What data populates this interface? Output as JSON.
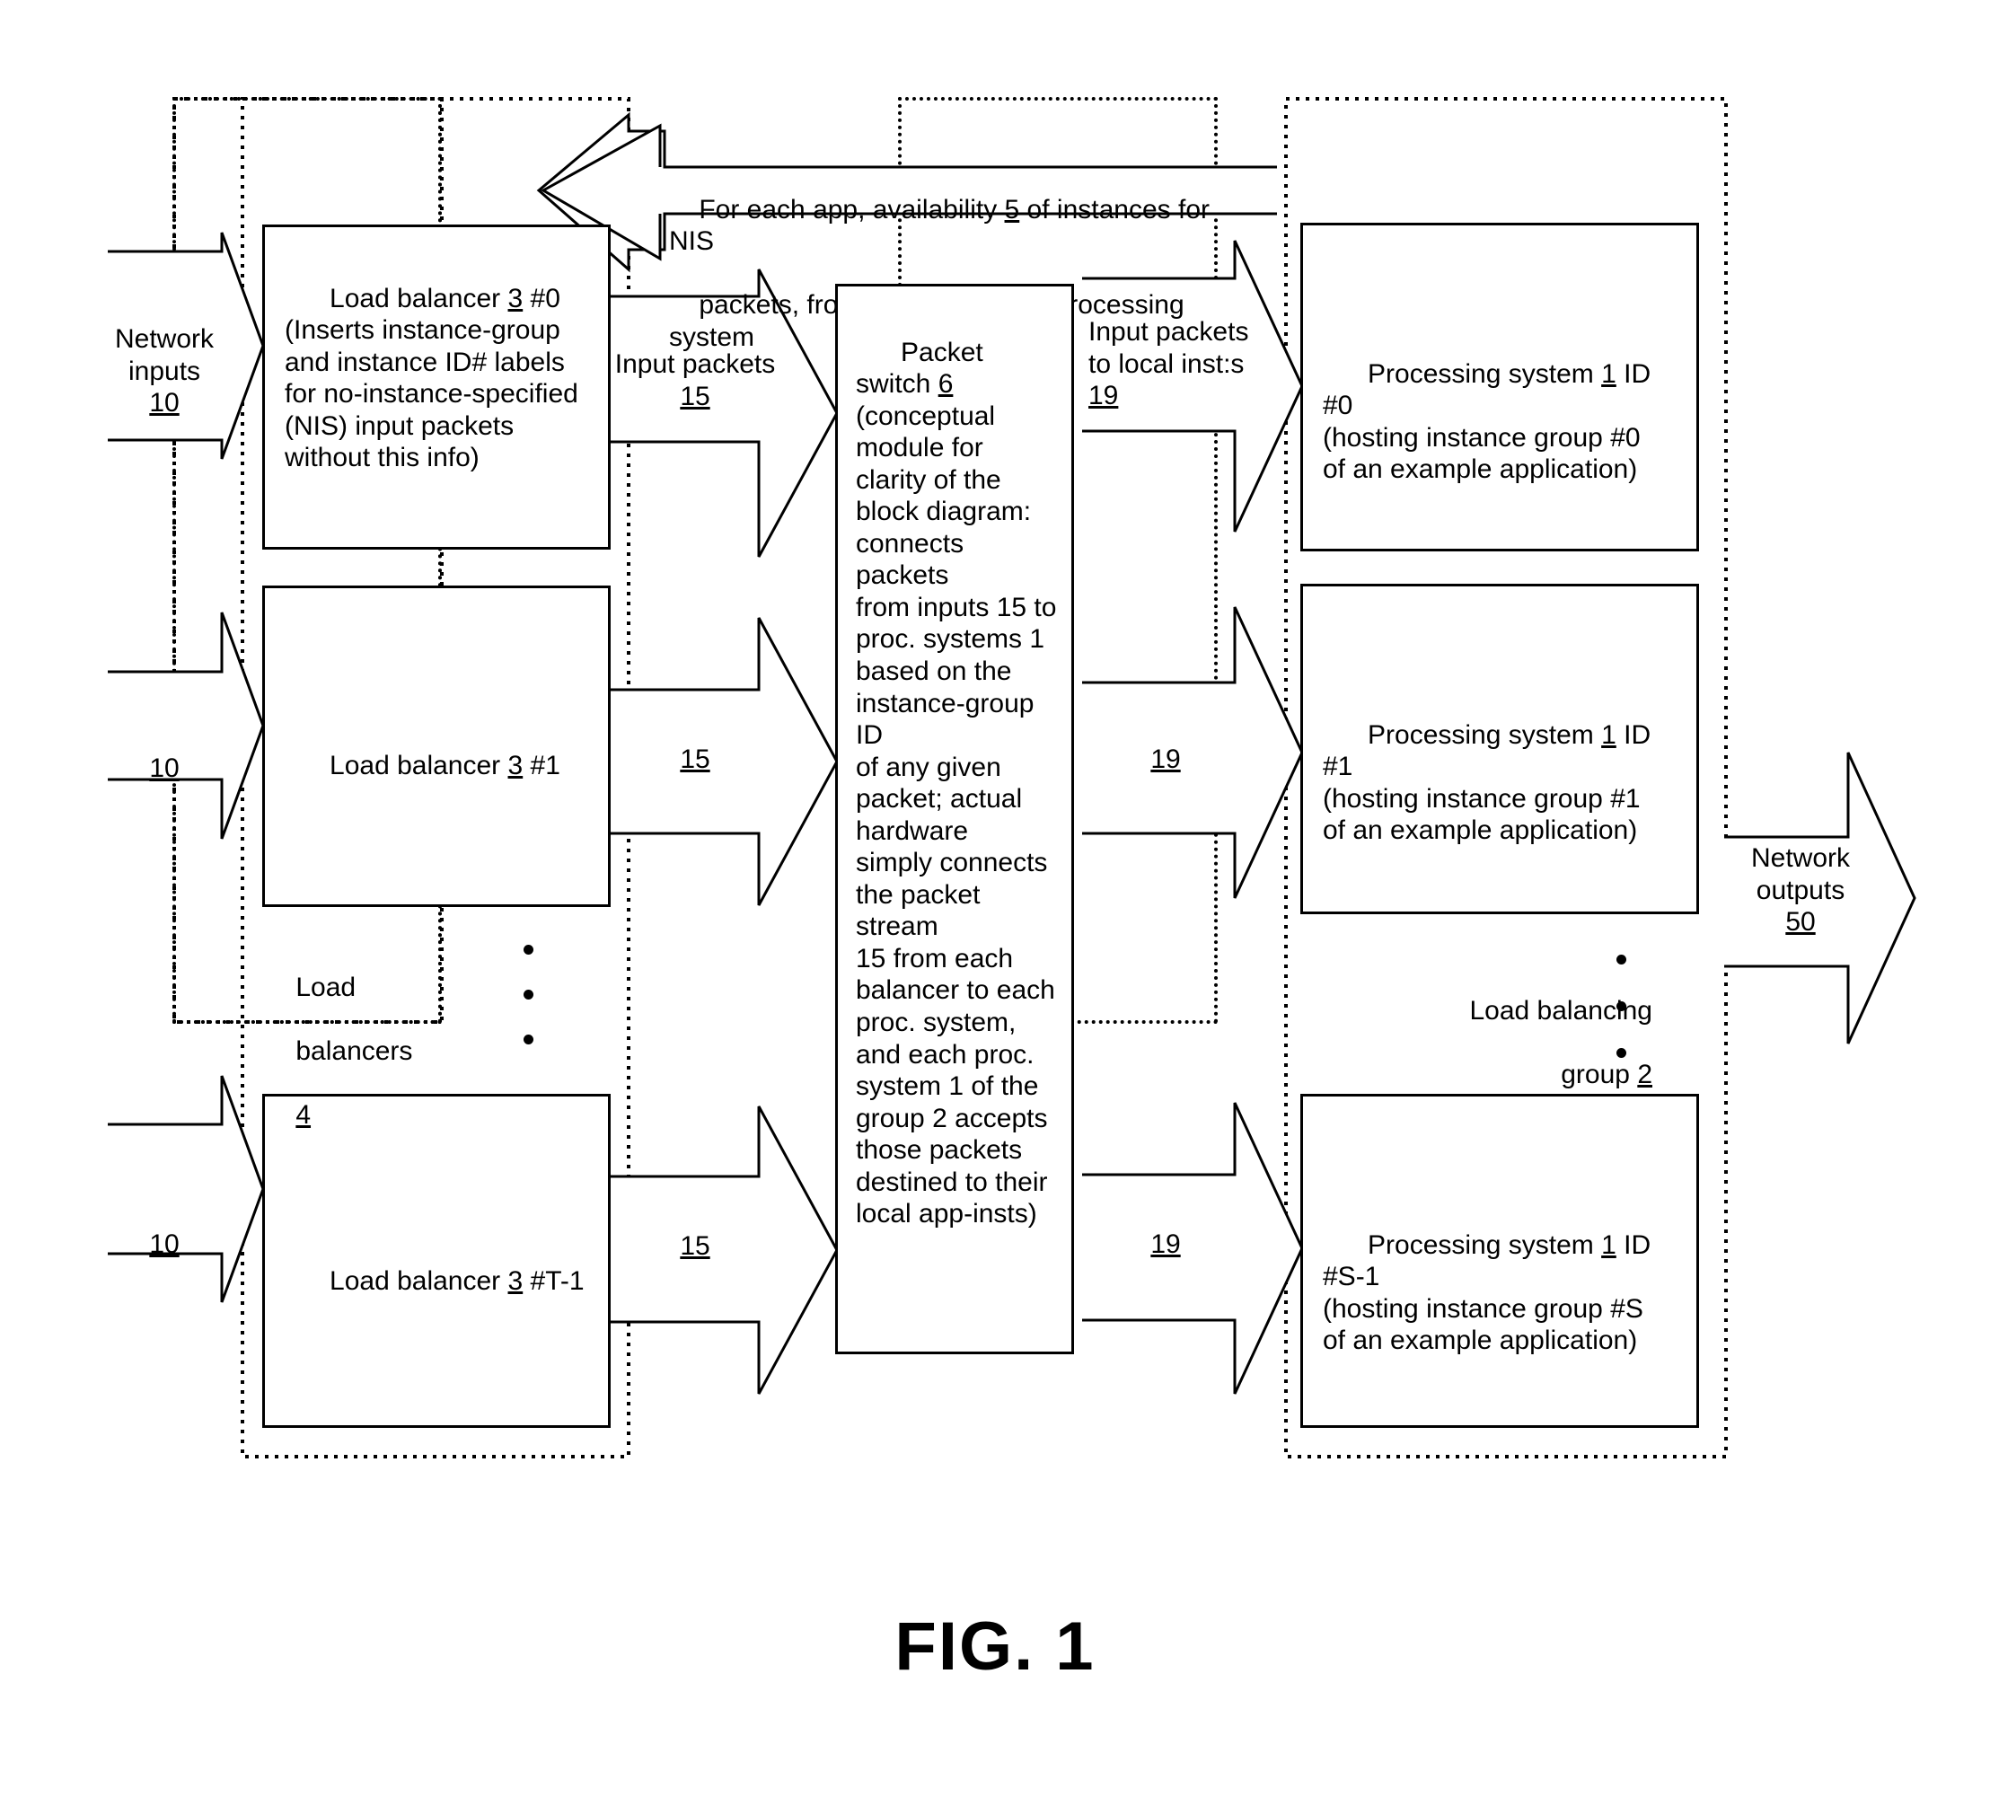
{
  "figure": {
    "caption": "FIG. 1"
  },
  "groups": {
    "load_balancer_group": {
      "label_line1": "Load",
      "label_line2": "balancers",
      "label_ref": "4"
    },
    "processing_group": {
      "label_line1": "Load balancing",
      "label_line2": "group",
      "label_ref": "2"
    }
  },
  "callout": {
    "line1_a": "For each app, availability ",
    "line1_ref": "5",
    "line1_b": " of instances for NIS",
    "line2": "packets, from each individual processing system"
  },
  "network": {
    "inputs_label_line1": "Network",
    "inputs_label_line2": "inputs",
    "inputs_ref": "10",
    "input_ref_2": "10",
    "input_ref_3": "10",
    "outputs_label_line1": "Network",
    "outputs_label_line2": "outputs",
    "outputs_ref": "50"
  },
  "load_balancers": [
    {
      "title_a": "Load balancer ",
      "title_ref": "3",
      "title_b": " #0",
      "body": "(Inserts instance-group\nand instance ID# labels\nfor no-instance-specified\n(NIS) input packets\nwithout this info)"
    },
    {
      "title_a": "Load balancer ",
      "title_ref": "3",
      "title_b": " #1",
      "body": ""
    },
    {
      "title_a": "Load balancer ",
      "title_ref": "3",
      "title_b": " #T-1",
      "body": ""
    }
  ],
  "input_packets": {
    "label_line1": "Input packets",
    "ref": "15",
    "ref_2": "15",
    "ref_3": "15"
  },
  "packet_switch": {
    "title_a": "Packet switch ",
    "title_ref": "6",
    "body": "(conceptual\nmodule for\nclarity of the\nblock diagram:\nconnects packets\nfrom inputs 15 to\nproc. systems 1\nbased on the\ninstance-group ID\nof any given\npacket; actual\nhardware\nsimply connects\nthe packet stream\n15 from each\nbalancer to each\nproc. system,\nand each proc.\nsystem 1 of the\ngroup 2 accepts\nthose packets\ndestined to their\nlocal app-insts)"
  },
  "local_packets": {
    "label_line1": "Input packets",
    "label_line2": "to local inst:s",
    "ref": "19",
    "ref_2": "19",
    "ref_3": "19"
  },
  "processing_systems": [
    {
      "title_a": "Processing system ",
      "title_ref": "1",
      "title_b": " ID #0",
      "body": "(hosting instance group #0\nof an example application)"
    },
    {
      "title_a": "Processing system ",
      "title_ref": "1",
      "title_b": " ID #1",
      "body": "(hosting instance group #1\nof an example application)"
    },
    {
      "title_a": "Processing system ",
      "title_ref": "1",
      "title_b": " ID #S-1",
      "body": "(hosting instance group #S\nof an example application)"
    }
  ],
  "colors": {
    "line": "#000000",
    "background": "#ffffff"
  }
}
